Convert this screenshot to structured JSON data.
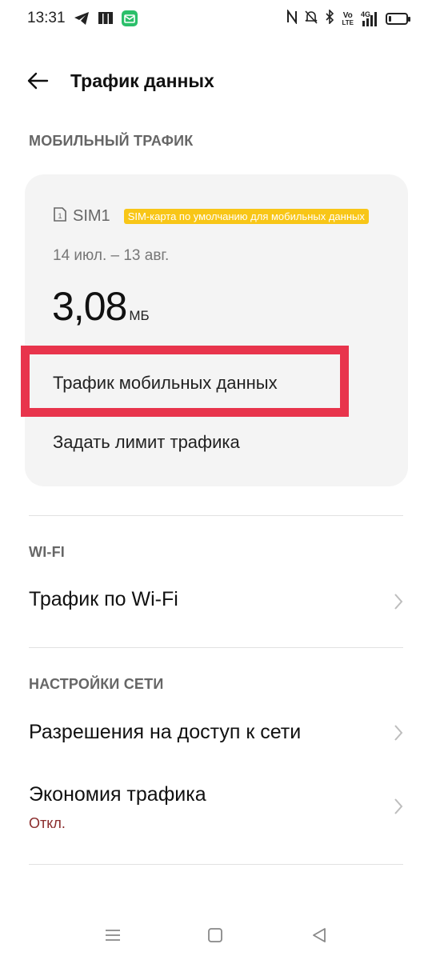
{
  "status_bar": {
    "time": "13:31",
    "net_vo": "Vo",
    "net_lte": "LTE",
    "net_4g": "4G",
    "battery_level": 0.15,
    "left_icons": [
      "telegram-icon",
      "sim-manager-icon",
      "mail-app-icon"
    ],
    "right_icons": [
      "nfc-icon",
      "mute-icon",
      "bluetooth-icon",
      "volte-icon",
      "signal-icon",
      "battery-icon"
    ]
  },
  "header": {
    "title": "Трафик данных"
  },
  "mobile_section": {
    "header": "МОБИЛЬНЫЙ ТРАФИК",
    "sim_label": "SIM1",
    "sim_badge": "SIM-карта по умолчанию для мобильных данных",
    "period": "14 июл. – 13 авг.",
    "usage_value": "3,08",
    "usage_unit": "МБ",
    "mobile_data_link": "Трафик мобильных данных",
    "limit_link": "Задать лимит трафика"
  },
  "wifi_section": {
    "header": "WI-FI",
    "item_label": "Трафик по Wi-Fi"
  },
  "network_section": {
    "header": "НАСТРОЙКИ СЕТИ",
    "permissions_label": "Разрешения на доступ к сети",
    "saver_label": "Экономия трафика",
    "saver_status": "Откл."
  },
  "colors": {
    "badge": "#f8c617",
    "highlight": "#e8344c",
    "status_off": "#8a2c2c",
    "card": "#f4f4f4"
  }
}
